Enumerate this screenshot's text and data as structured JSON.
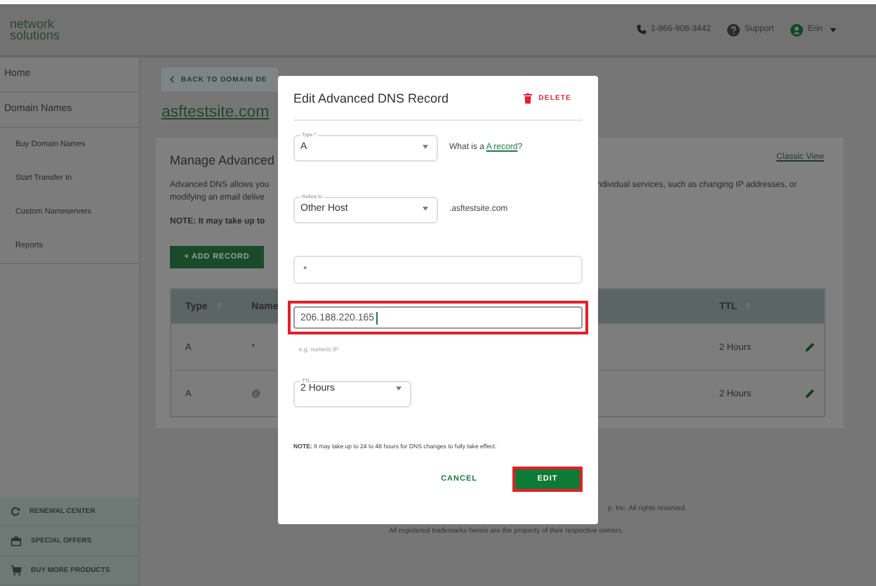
{
  "header": {
    "logo": [
      "network",
      "solutions"
    ],
    "phone": "1-866-908-3442",
    "support": "Support",
    "user": "Erin"
  },
  "sidebar": {
    "items": [
      {
        "label": "Home"
      },
      {
        "label": "Domain Names",
        "children": [
          {
            "label": "Buy Domain Names"
          },
          {
            "label": "Start Transfer In"
          },
          {
            "label": "Custom Nameservers"
          },
          {
            "label": "Reports"
          }
        ]
      }
    ],
    "footer_links": [
      "RENEWAL CENTER",
      "SPECIAL OFFERS",
      "BUY MORE PRODUCTS"
    ]
  },
  "page": {
    "back": "BACK TO DOMAIN DE",
    "domain": "asftestsite.com",
    "card": {
      "title": "Manage Advanced",
      "classic_view": "Classic View",
      "description_left": [
        "Advanced DNS allows you",
        "modifying an email delive"
      ],
      "description_right": "ndividual services, such as changing IP addresses, or",
      "note": "NOTE: It may take up to",
      "add_record": "+ ADD RECORD"
    },
    "table": {
      "columns": [
        "Type",
        "Name",
        "TTL"
      ],
      "rows": [
        {
          "type": "A",
          "name": "*",
          "ttl": "2 Hours"
        },
        {
          "type": "A",
          "name": "@",
          "ttl": "2 Hours"
        }
      ]
    },
    "footer": [
      "p. Inc. All rights reserved.",
      "All registered trademarks herein are the property of their respective owners."
    ]
  },
  "dialog": {
    "title": "Edit Advanced DNS Record",
    "delete": "DELETE",
    "type": {
      "label": "Type *",
      "value": "A"
    },
    "help_parts": [
      "What is a ",
      "A record",
      "?"
    ],
    "refers_to": {
      "label": "Refers to",
      "value": "Other Host"
    },
    "suffix": ".asftestsite.com",
    "host": {
      "value": "*"
    },
    "address": {
      "value": "206.188.220.165",
      "highlighted": true,
      "hint": "e.g. numeric IP"
    },
    "ttl": {
      "label": "TTL",
      "value": "2 Hours"
    },
    "note": "**NOTE:** It may take up to 24 to 48 hours for DNS changes to fully take effect.",
    "cancel": "CANCEL",
    "submit": {
      "label": "EDIT",
      "highlighted": true
    }
  }
}
